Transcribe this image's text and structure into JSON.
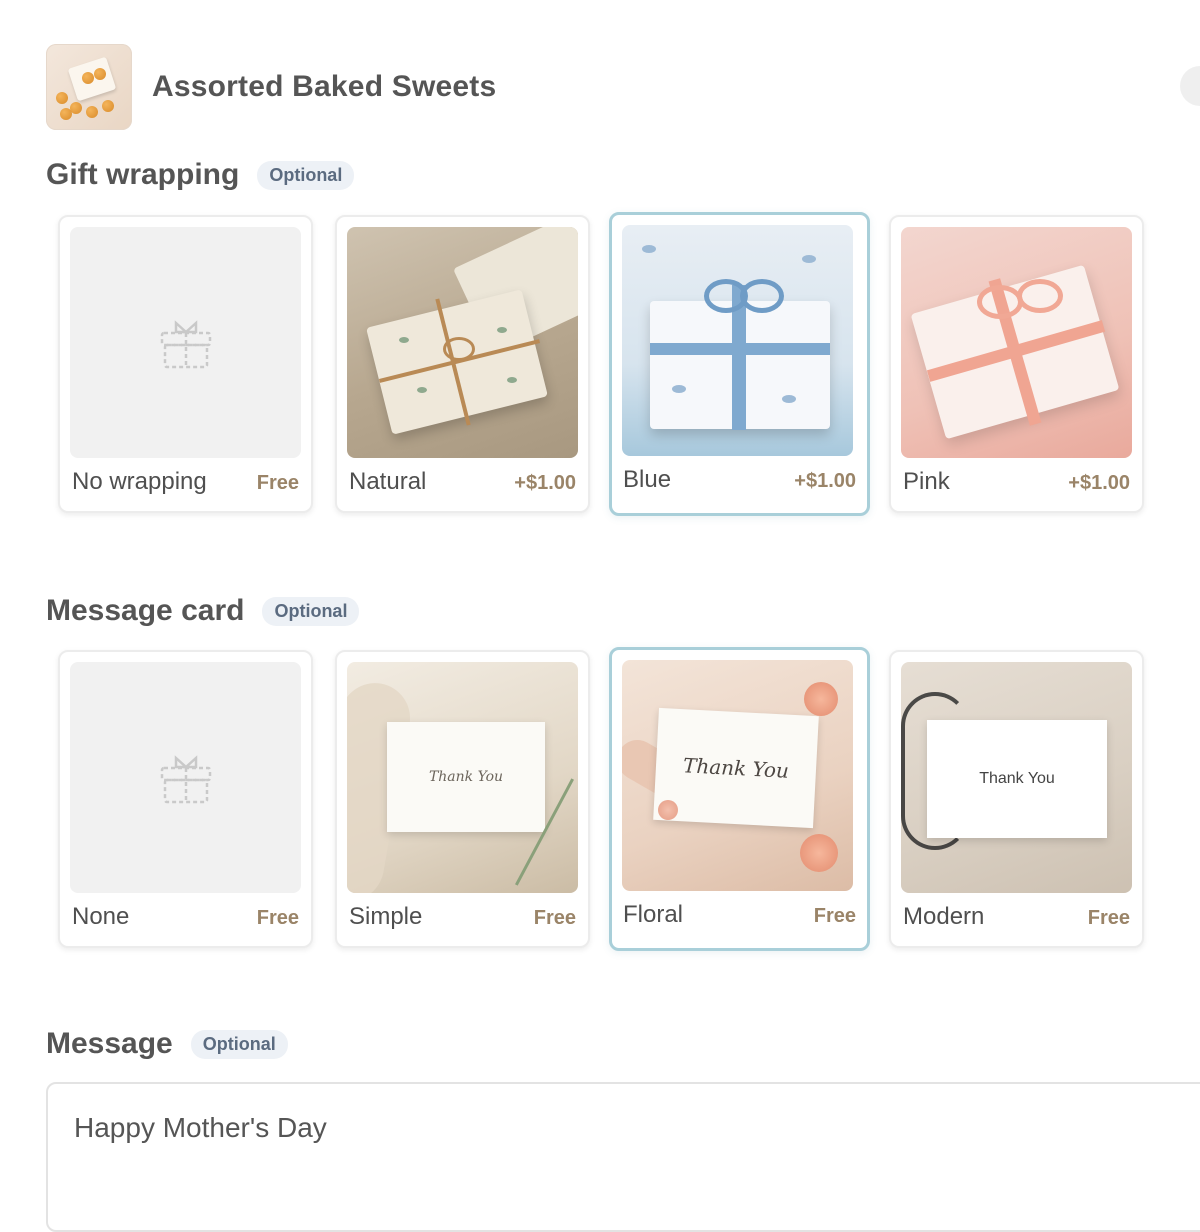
{
  "product": {
    "name": "Assorted Baked Sweets"
  },
  "gift_wrapping": {
    "title": "Gift wrapping",
    "badge": "Optional",
    "selected": "Blue",
    "options": [
      {
        "label": "No wrapping",
        "price": "Free"
      },
      {
        "label": "Natural",
        "price": "+$1.00"
      },
      {
        "label": "Blue",
        "price": "+$1.00"
      },
      {
        "label": "Pink",
        "price": "+$1.00"
      }
    ]
  },
  "message_card": {
    "title": "Message card",
    "badge": "Optional",
    "selected": "Floral",
    "options": [
      {
        "label": "None",
        "price": "Free"
      },
      {
        "label": "Simple",
        "price": "Free",
        "card_text": "Thank You"
      },
      {
        "label": "Floral",
        "price": "Free",
        "card_text": "Thank You"
      },
      {
        "label": "Modern",
        "price": "Free",
        "card_text": "Thank You"
      }
    ]
  },
  "message": {
    "title": "Message",
    "badge": "Optional",
    "value": "Happy Mother's Day"
  },
  "colors": {
    "selected_border": "#a9cfd9",
    "price": "#9a8468",
    "badge_bg": "#edf1f6"
  }
}
